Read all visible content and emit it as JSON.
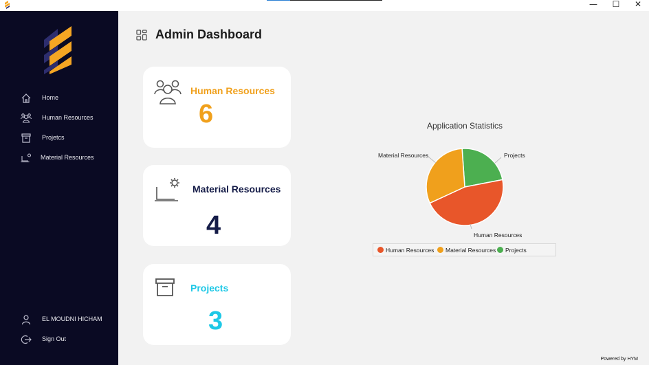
{
  "window": {
    "minimize_glyph": "—",
    "maximize_glyph": "☐",
    "close_glyph": "✕"
  },
  "sidebar": {
    "items": [
      {
        "label": "Home",
        "icon": "home-icon"
      },
      {
        "label": "Human Resources",
        "icon": "people-icon"
      },
      {
        "label": "Projetcs",
        "icon": "archive-icon"
      },
      {
        "label": "Material Resources",
        "icon": "laptop-gear-icon"
      }
    ],
    "user": {
      "label": "EL MOUDNI HICHAM",
      "icon": "user-icon"
    },
    "signout": {
      "label": "Sign Out",
      "icon": "sign-out-icon"
    }
  },
  "header": {
    "title": "Admin Dashboard",
    "icon": "dashboard-icon"
  },
  "cards": [
    {
      "name": "Human Resources",
      "count": "6",
      "color": "#f0a01c",
      "icon": "people-icon"
    },
    {
      "name": "Material Resources",
      "count": "4",
      "color": "#151c48",
      "icon": "laptop-gear-icon"
    },
    {
      "name": "Projects",
      "count": "3",
      "color": "#1ec8e6",
      "icon": "archive-icon"
    }
  ],
  "chart_data": {
    "type": "pie",
    "title": "Application Statistics",
    "categories": [
      "Human Resources",
      "Material Resources",
      "Projects"
    ],
    "values": [
      6,
      4,
      3
    ],
    "colors": [
      "#e8562a",
      "#f0a01c",
      "#4caf50"
    ],
    "legend": "bottom"
  },
  "footer": {
    "text": "Powered by HYM"
  },
  "colors": {
    "sidebar_bg": "#0a0a23",
    "page_bg": "#f2f2f2",
    "card_bg": "#ffffff"
  }
}
